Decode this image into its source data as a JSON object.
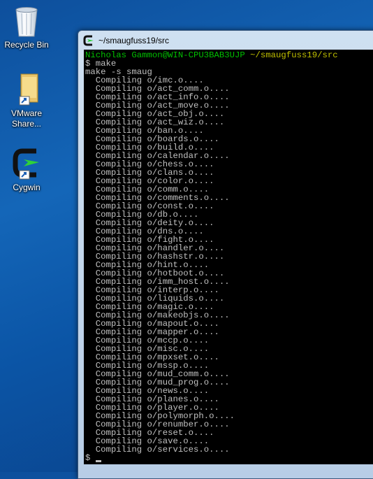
{
  "desktop": {
    "icons": [
      {
        "label": "Recycle Bin"
      },
      {
        "label": "VMware Share..."
      },
      {
        "label": "Cygwin"
      }
    ]
  },
  "window": {
    "title": "~/smaugfuss19/src",
    "prompt_user": "Nicholas Gammon@WIN-CPU3BAB3UJP",
    "prompt_path": "~/smaugfuss19/src",
    "lines": [
      "$ make",
      "make -s smaug",
      "  Compiling o/imc.o....",
      "  Compiling o/act_comm.o....",
      "  Compiling o/act_info.o....",
      "  Compiling o/act_move.o....",
      "  Compiling o/act_obj.o....",
      "  Compiling o/act_wiz.o....",
      "  Compiling o/ban.o....",
      "  Compiling o/boards.o....",
      "  Compiling o/build.o....",
      "  Compiling o/calendar.o....",
      "  Compiling o/chess.o....",
      "  Compiling o/clans.o....",
      "  Compiling o/color.o....",
      "  Compiling o/comm.o....",
      "  Compiling o/comments.o....",
      "  Compiling o/const.o....",
      "  Compiling o/db.o....",
      "  Compiling o/deity.o....",
      "  Compiling o/dns.o....",
      "  Compiling o/fight.o....",
      "  Compiling o/handler.o....",
      "  Compiling o/hashstr.o....",
      "  Compiling o/hint.o....",
      "  Compiling o/hotboot.o....",
      "  Compiling o/imm_host.o....",
      "  Compiling o/interp.o....",
      "  Compiling o/liquids.o....",
      "  Compiling o/magic.o....",
      "  Compiling o/makeobjs.o....",
      "  Compiling o/mapout.o....",
      "  Compiling o/mapper.o....",
      "  Compiling o/mccp.o....",
      "  Compiling o/misc.o....",
      "  Compiling o/mpxset.o....",
      "  Compiling o/mssp.o....",
      "  Compiling o/mud_comm.o....",
      "  Compiling o/mud_prog.o....",
      "  Compiling o/news.o....",
      "  Compiling o/planes.o....",
      "  Compiling o/player.o....",
      "  Compiling o/polymorph.o....",
      "  Compiling o/renumber.o....",
      "  Compiling o/reset.o....",
      "  Compiling o/save.o....",
      "  Compiling o/services.o....",
      "$"
    ]
  },
  "colors": {
    "prompt_user": "#00c000",
    "prompt_path": "#c0c000",
    "terminal_bg": "#000000",
    "terminal_text": "#c0c0c0"
  }
}
